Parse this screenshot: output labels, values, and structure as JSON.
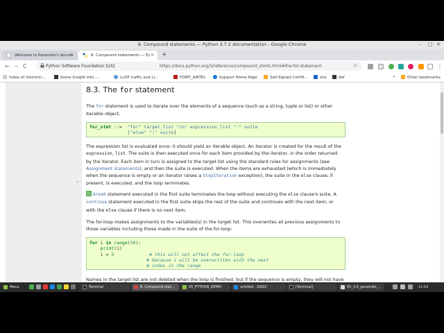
{
  "window": {
    "title": "8. Compound statements — Python 3.7.2 documentation - Google Chrome",
    "controls": [
      "–",
      "□",
      "✕"
    ]
  },
  "tabs": [
    {
      "label": "Welcome to Paramiko's docum",
      "close": "×"
    },
    {
      "label": "8. Compound statements — Py",
      "close": "×"
    }
  ],
  "new_tab": "+",
  "toolbar": {
    "back": "←",
    "forward": "→",
    "reload": "C",
    "home": "⌂",
    "lock": "🔒",
    "site": "Python Software Foundation [US]",
    "url": "https://docs.python.org/3/reference/compound_stmts.html#the-for-statement",
    "star": "☆",
    "menu": "⋮"
  },
  "bookmarks": [
    {
      "label": "Index of /mirrors/..."
    },
    {
      "label": "Some Insight into ..."
    },
    {
      "label": "LLDP traffic and Li..."
    },
    {
      "label": "FORTI_AIRTEL"
    },
    {
      "label": "Support Home Page"
    },
    {
      "label": "Self-Signed Certifi..."
    },
    {
      "label": "dns"
    },
    {
      "label": "def"
    },
    {
      "label": "»"
    },
    {
      "label": "Other bookmarks"
    }
  ],
  "doc": {
    "heading_prefix": "8.3. The ",
    "heading_code": "for",
    "heading_suffix": " statement",
    "p1": {
      "a": "The ",
      "b": "for",
      "c": " statement is used to iterate over the elements of a sequence (such as a string, tuple or list) or other",
      "d": "iterable object:"
    },
    "grammar": {
      "l1a": "for_stmt",
      "l1b": " ::=  ",
      "l1c": "\"for\"",
      "l1d": " target_list",
      "l1e": " \"in\"",
      "l1f": " expression_list",
      "l1g": " \":\"",
      "l1h": " suite",
      "l2a": "[\"else\" \":\"",
      "l2b": " suite",
      "l2c": "]"
    },
    "p2": {
      "l1": "The expression list is evaluated once; it should yield an iterable object. An iterator is created for the result of the",
      "l2a": "expression_list",
      "l2b": ". The suite is then executed once for each item provided by the iterator, in the order returned",
      "l3": "by the iterator. Each item in turn is assigned to the target list using the standard rules for assignments (see",
      "l4a": "Assignment statements",
      "l4b": "), and then the suite is executed. When the items are exhausted (which is immediately",
      "l5a": "when the sequence is empty or an iterator raises a ",
      "l5b": "StopIteration",
      "l5c": " exception), the suite in the ",
      "l5d": "else",
      "l5e": " clause, if",
      "l6": "present, is executed, and the loop terminates."
    },
    "p3": {
      "l1a": "A ",
      "l1b": "break",
      "l1c": " statement executed in the first suite terminates the loop without executing the ",
      "l1d": "else",
      "l1e": " clause's suite. A",
      "l2a": "continue",
      "l2b": " statement executed in the first suite skips the rest of the suite and continues with the next item, or",
      "l3a": "with the ",
      "l3b": "else",
      "l3c": " clause if there is no next item."
    },
    "p4": {
      "l1": "The for-loop makes assignments to the variables(s) in the target list. This overwrites all previous assignments to",
      "l2": "those variables including those made in the suite of the for-loop:"
    },
    "example": {
      "l1a": "for",
      "l1b": " i ",
      "l1c": "in",
      "l1d": " range",
      "l1e": "(",
      "l1f": "10",
      "l1g": "):",
      "l2a": "    print",
      "l2b": "(i)",
      "l3a": "    i = ",
      "l3b": "5",
      "l3c": "             # this will not affect the for-loop",
      "l4": "                     # because i will be overwritten with the next",
      "l5": "                     # index in the range"
    },
    "p5": "Names in the target list are not deleted when the loop is finished, but if the sequence is empty, they will not have"
  },
  "taskbar": {
    "menu": "Menu",
    "items": [
      "Terminal",
      "8. Compound stat...",
      "05_PYTHON_DEMO",
      "untitled - GNS3",
      "[Terminal]",
      "05_3.6_paramiko_..."
    ],
    "clock": "11:52"
  },
  "colors": {
    "code_bg": "#eeffcc",
    "link": "#3b6ea5",
    "keyword": "#007020"
  }
}
